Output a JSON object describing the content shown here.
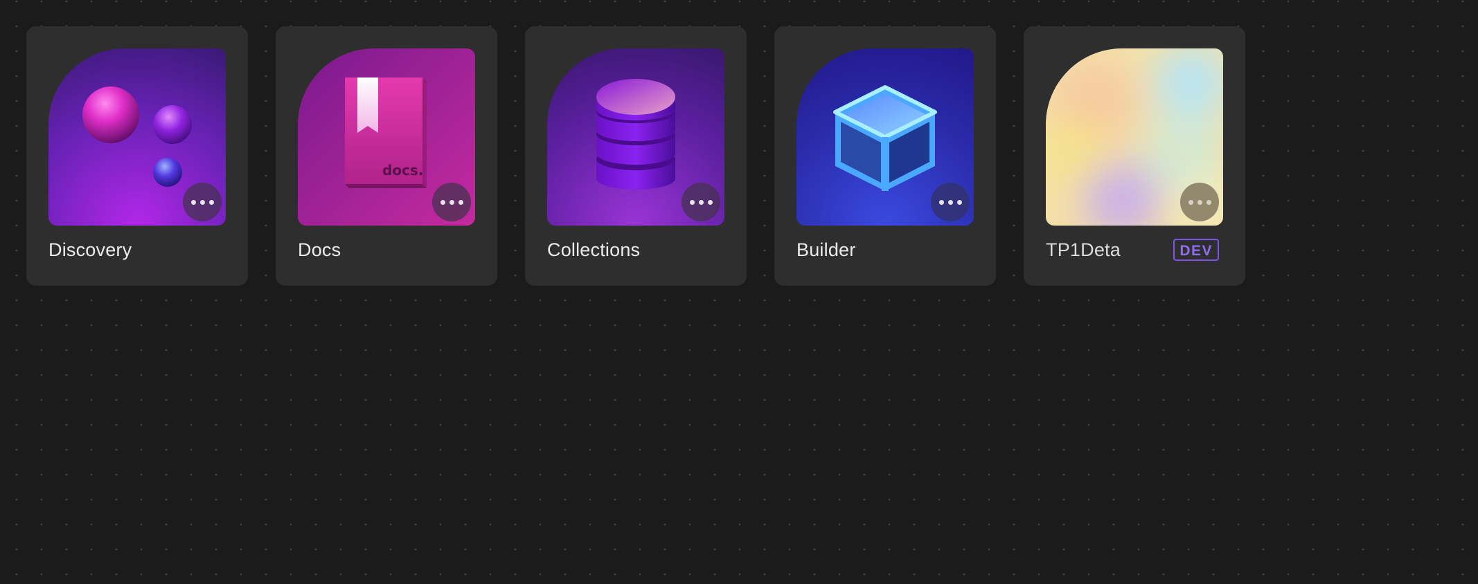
{
  "apps": [
    {
      "name": "Discovery",
      "icon": "spheres-icon",
      "more_icon": "more-options-icon"
    },
    {
      "name": "Docs",
      "icon": "book-icon",
      "book_text": "docs.",
      "more_icon": "more-options-icon"
    },
    {
      "name": "Collections",
      "icon": "database-icon",
      "more_icon": "more-options-icon"
    },
    {
      "name": "Builder",
      "icon": "cube-icon",
      "more_icon": "more-options-icon"
    },
    {
      "name": "TP1Deta",
      "icon": "gradient-blob-icon",
      "badge": "DEV",
      "more_icon": "more-options-icon"
    }
  ],
  "colors": {
    "background": "#1b1b1b",
    "card": "#2f2e2e",
    "badge_accent": "#7a55e8",
    "label_text": "#ededed"
  }
}
